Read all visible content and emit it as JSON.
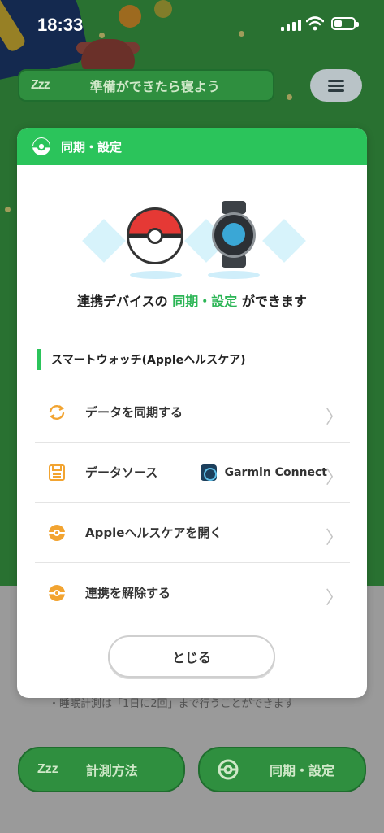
{
  "status_bar": {
    "time": "18:33"
  },
  "top_pill": {
    "zzz": "Zzz",
    "label": "準備ができたら寝よう"
  },
  "modal": {
    "title": "同期・設定",
    "subtitle_pre": "連携デバイスの",
    "subtitle_highlight": "同期・設定",
    "subtitle_post": "ができます",
    "section_label": "スマートウォッチ(Appleヘルスケア)",
    "rows": [
      {
        "label": "データを同期する",
        "icon": "sync-icon"
      },
      {
        "label": "データソース",
        "icon": "floppy-disk-icon",
        "value": "Garmin Connect"
      },
      {
        "label": "Appleヘルスケアを開く",
        "icon": "pokeball-icon"
      },
      {
        "label": "連携を解除する",
        "icon": "pokeball-icon"
      }
    ],
    "close_label": "とじる"
  },
  "footer": {
    "note": "・睡眠計測は「1日に2回」まで行うことができます",
    "left_button": {
      "label": "計測方法"
    },
    "right_button": {
      "label": "同期・設定"
    }
  },
  "colors": {
    "accent_green": "#2bc45b",
    "icon_orange": "#f2a431"
  }
}
